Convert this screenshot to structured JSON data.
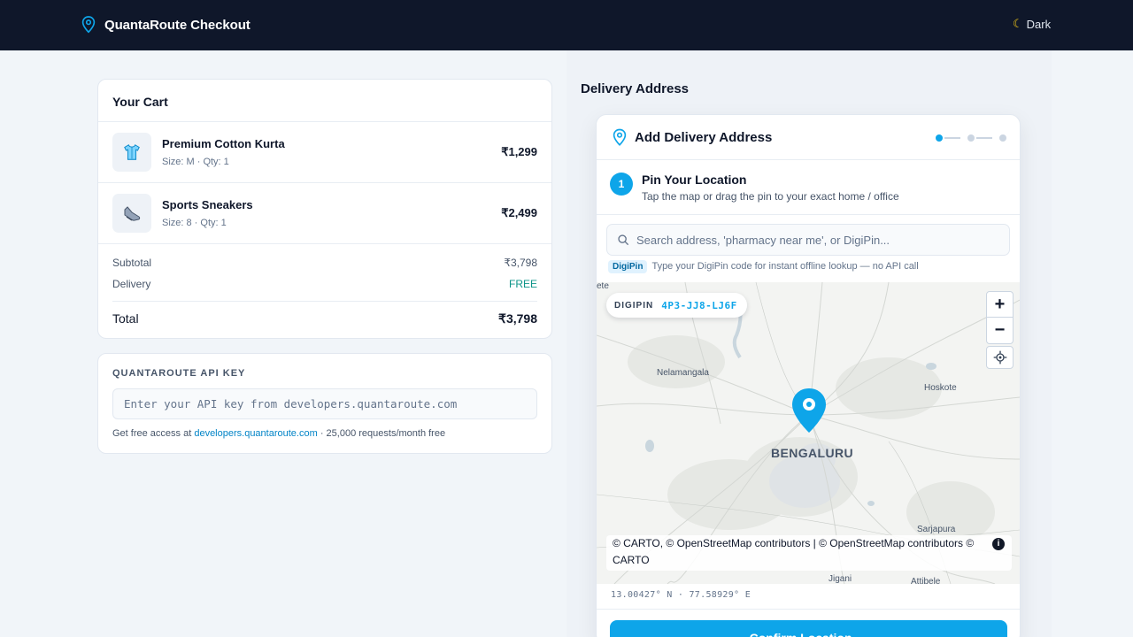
{
  "header": {
    "brand": "QuantaRoute Checkout",
    "theme_label": "Dark"
  },
  "cart": {
    "title": "Your Cart",
    "items": [
      {
        "name": "Premium Cotton Kurta",
        "meta": "Size: M · Qty: 1",
        "price": "₹1,299",
        "icon": "shirt-icon"
      },
      {
        "name": "Sports Sneakers",
        "meta": "Size: 8 · Qty: 1",
        "price": "₹2,499",
        "icon": "sneaker-icon"
      }
    ],
    "subtotal_label": "Subtotal",
    "subtotal_value": "₹3,798",
    "delivery_label": "Delivery",
    "delivery_value": "FREE",
    "total_label": "Total",
    "total_value": "₹3,798"
  },
  "api": {
    "title": "QUANTAROUTE API KEY",
    "placeholder": "Enter your API key from developers.quantaroute.com",
    "help_prefix": "Get free access at",
    "help_link": "developers.quantaroute.com",
    "help_suffix": "· 25,000 requests/month free"
  },
  "delivery": {
    "section_title": "Delivery Address",
    "panel_title": "Add Delivery Address",
    "step_number": "1",
    "step_title": "Pin Your Location",
    "step_subtitle": "Tap the map or drag the pin to your exact home / office",
    "search_placeholder": "Search address, 'pharmacy near me', or DigiPin...",
    "digipin_badge": "DigiPin",
    "digipin_hint": "Type your DigiPin code for instant offline lookup — no API call",
    "map": {
      "digipin_label": "DIGIPIN",
      "digipin_code": "4P3-JJ8-LJ6F",
      "zoom_in": "+",
      "zoom_out": "−",
      "places": {
        "nelamangala": "Nelamangala",
        "hoskote": "Hoskote",
        "city": "BENGALURU",
        "sarjapura": "Sarjapura",
        "jigani": "Jigani",
        "attibele": "Attibele",
        "top_left": "ete"
      },
      "attribution": "© CARTO, © OpenStreetMap contributors | © OpenStreetMap contributors © CARTO",
      "info": "i"
    },
    "coordinates": "13.00427° N · 77.58929° E",
    "confirm_label": "Confirm Location →"
  },
  "colors": {
    "accent": "#0ea5e9",
    "header_bg": "#0f172a",
    "free": "#0d9488"
  }
}
